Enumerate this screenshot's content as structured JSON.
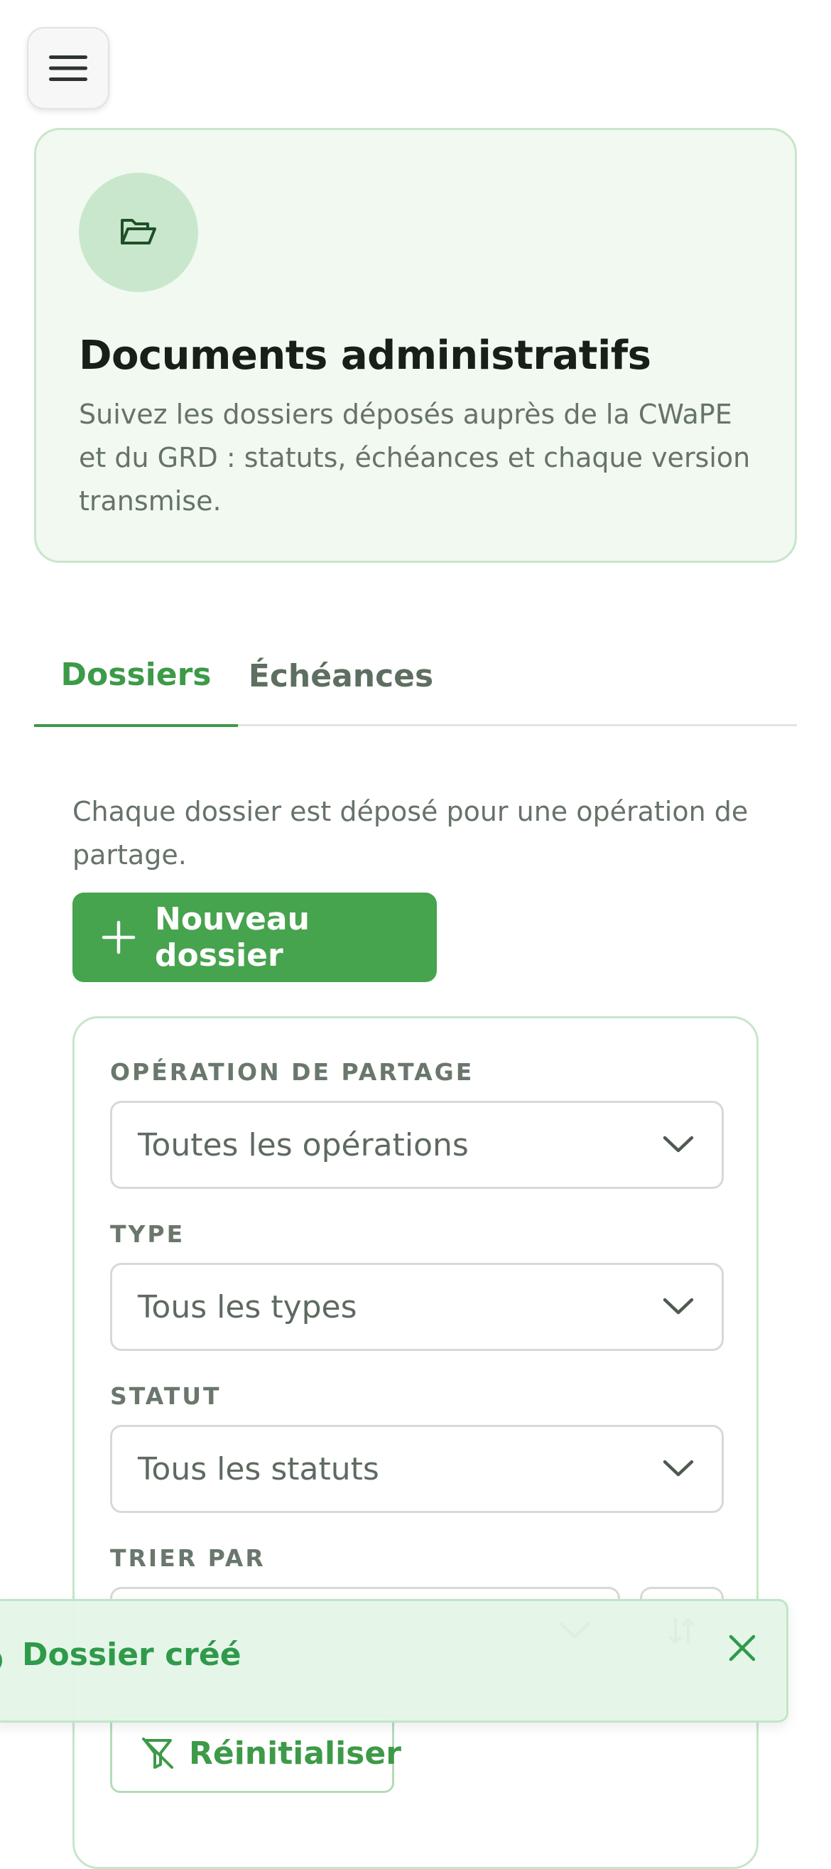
{
  "header": {
    "menu_icon": "hamburger-menu-icon"
  },
  "hero": {
    "icon": "folder-open-icon",
    "title": "Documents administratifs",
    "description": "Suivez les dossiers déposés auprès de la CWaPE et du GRD : statuts, échéances et chaque version transmise."
  },
  "tabs": [
    {
      "label": "Dossiers",
      "active": true
    },
    {
      "label": "Échéances",
      "active": false
    }
  ],
  "main": {
    "intro": "Chaque dossier est déposé pour une opération de partage.",
    "new_button_label": "Nouveau dossier"
  },
  "filters": {
    "operation_label": "OPÉRATION DE PARTAGE",
    "operation_value": "Toutes les opérations",
    "type_label": "TYPE",
    "type_value": "Tous les types",
    "status_label": "STATUT",
    "status_value": "Tous les statuts",
    "sort_label": "TRIER PAR",
    "reset_label": "Réinitialiser"
  },
  "toast": {
    "message": "Dossier créé",
    "close_icon": "close-icon"
  },
  "colors": {
    "accent": "#46a34e",
    "accent_text": "#3d9a48",
    "hero_bg": "#f1f9f1",
    "toast_bg": "#e4f6e8"
  }
}
